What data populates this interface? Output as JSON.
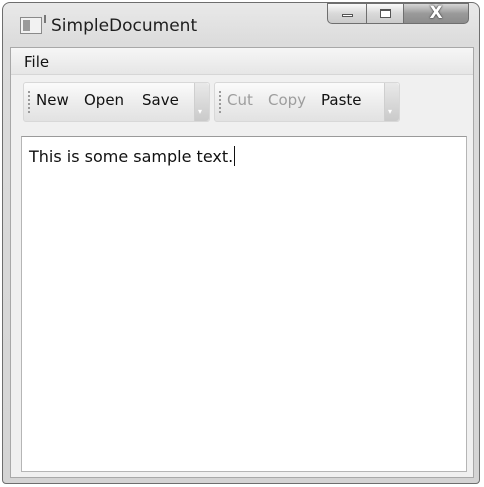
{
  "window": {
    "title": "SimpleDocument",
    "close_glyph": "X"
  },
  "menu": {
    "items": [
      {
        "label": "File"
      }
    ]
  },
  "toolbars": [
    {
      "items": [
        {
          "label": "New",
          "enabled": true
        },
        {
          "label": "Open",
          "enabled": true
        },
        {
          "label": "Save",
          "enabled": true
        }
      ]
    },
    {
      "items": [
        {
          "label": "Cut",
          "enabled": false
        },
        {
          "label": "Copy",
          "enabled": false
        },
        {
          "label": "Paste",
          "enabled": true
        }
      ]
    }
  ],
  "overflow_glyph": "▾",
  "editor": {
    "text": "This is some sample text."
  },
  "colors": {
    "disabled_text": "#9d9d9d",
    "text": "#111111"
  }
}
